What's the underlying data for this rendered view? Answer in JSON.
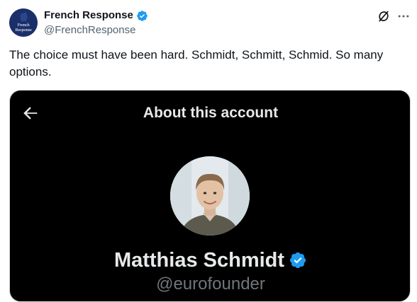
{
  "tweet": {
    "author": {
      "name": "French Response",
      "handle": "@FrenchResponse",
      "avatar_text_line1": "French",
      "avatar_text_line2": "Response",
      "verified": true
    },
    "text": "The choice must have been hard. Schmidt, Schmitt, Schmid. So many options.",
    "icons": {
      "grok": "grok-icon",
      "more": "more-options-icon"
    }
  },
  "media": {
    "screen_title": "About this account",
    "profile_name": "Matthias Schmidt",
    "profile_handle": "@eurofounder",
    "verified": true,
    "icons": {
      "back": "back-arrow-icon",
      "verified": "verified-badge-icon"
    }
  },
  "colors": {
    "verified_blue": "#1d9bf0",
    "avatar_bg": "#1a2f6a",
    "media_bg": "#000000",
    "secondary_text": "#536471"
  }
}
